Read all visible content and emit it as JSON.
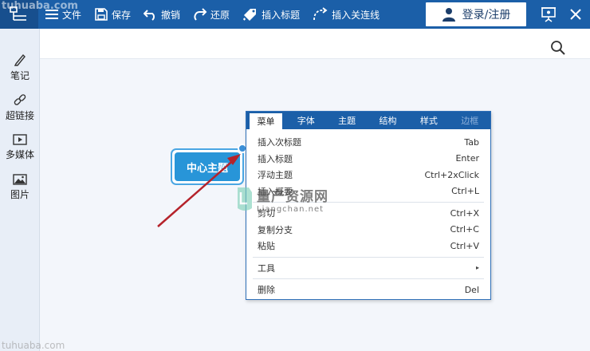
{
  "toolbar": {
    "file": "文件",
    "save": "保存",
    "undo": "撤销",
    "redo": "还原",
    "insert_topic": "插入标题",
    "insert_relation": "插入关连线",
    "login": "登录/注册"
  },
  "sidebar": {
    "items": [
      {
        "label": "笔记",
        "icon": "pencil-icon"
      },
      {
        "label": "超链接",
        "icon": "link-icon"
      },
      {
        "label": "多媒体",
        "icon": "media-icon"
      },
      {
        "label": "图片",
        "icon": "image-icon"
      }
    ]
  },
  "canvas": {
    "center_topic": "中心主题"
  },
  "context_menu": {
    "tabs": [
      "菜单",
      "字体",
      "主题",
      "结构",
      "样式",
      "边框"
    ],
    "items": [
      {
        "label": "插入次标题",
        "shortcut": "Tab"
      },
      {
        "label": "插入标题",
        "shortcut": "Enter"
      },
      {
        "label": "浮动主题",
        "shortcut": "Ctrl+2xClick"
      },
      {
        "label": "插入概要",
        "shortcut": "Ctrl+L"
      },
      {
        "label": "剪切",
        "shortcut": "Ctrl+X"
      },
      {
        "label": "复制分支",
        "shortcut": "Ctrl+C"
      },
      {
        "label": "粘贴",
        "shortcut": "Ctrl+V"
      },
      {
        "label": "工具",
        "shortcut": "▸"
      },
      {
        "label": "删除",
        "shortcut": "Del"
      }
    ]
  },
  "watermarks": {
    "top_left": "tuhuaba.com",
    "bottom_left": "tuhuaba.com",
    "center_cn": "量产资源网",
    "center_en": "Liangchan.net"
  },
  "colors": {
    "toolbar_bg": "#1b5fa8",
    "accent": "#2895d8",
    "arrow": "#c0282f"
  }
}
